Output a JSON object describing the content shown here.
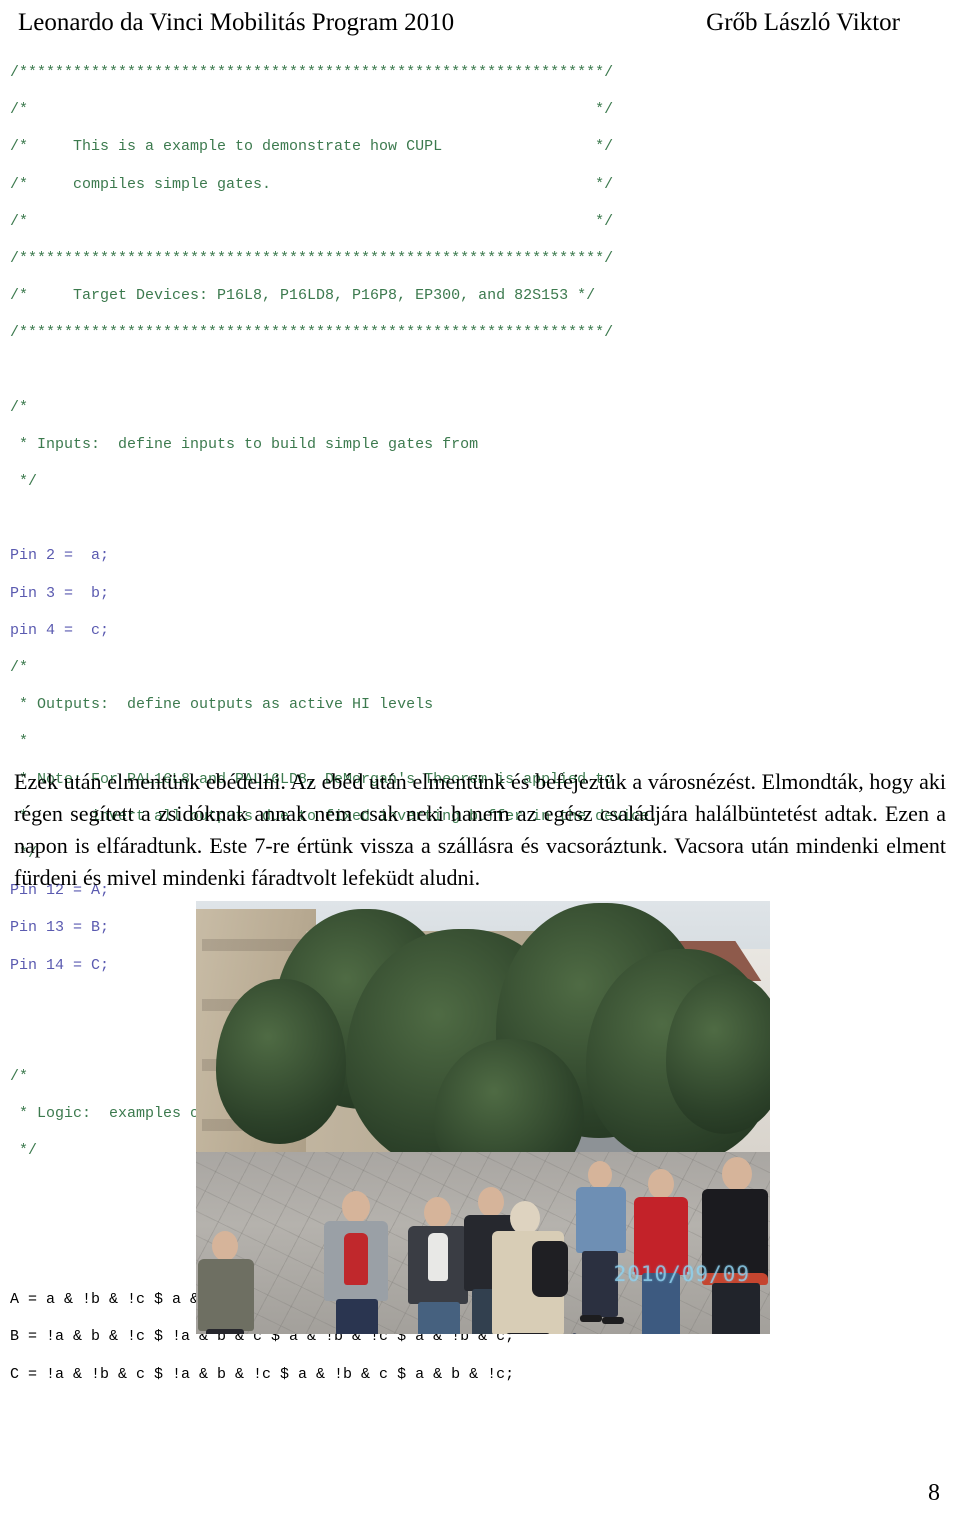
{
  "header": {
    "program_title": "Leonardo da Vinci Mobilitás Program 2010",
    "author": "Grőb László Viktor"
  },
  "code": {
    "language": "CUPL",
    "comment_color": "#3c7a4e",
    "pin_color": "#5a5ab0",
    "logic_color": "#000000",
    "lines": [
      {
        "text": "/*****************************************************************/",
        "kind": "comment"
      },
      {
        "text": "/*                                                               */",
        "kind": "comment"
      },
      {
        "text": "/*     This is a example to demonstrate how CUPL                 */",
        "kind": "comment"
      },
      {
        "text": "/*     compiles simple gates.                                    */",
        "kind": "comment"
      },
      {
        "text": "/*                                                               */",
        "kind": "comment"
      },
      {
        "text": "/*****************************************************************/",
        "kind": "comment"
      },
      {
        "text": "/*     Target Devices: P16L8, P16LD8, P16P8, EP300, and 82S153 */",
        "kind": "comment"
      },
      {
        "text": "/*****************************************************************/",
        "kind": "comment"
      },
      {
        "text": "",
        "kind": "blank"
      },
      {
        "text": "/*",
        "kind": "comment"
      },
      {
        "text": " * Inputs:  define inputs to build simple gates from",
        "kind": "comment"
      },
      {
        "text": " */",
        "kind": "comment"
      },
      {
        "text": "",
        "kind": "blank"
      },
      {
        "text": "Pin 2 =  a;",
        "kind": "pin"
      },
      {
        "text": "Pin 3 =  b;",
        "kind": "pin"
      },
      {
        "text": "pin 4 =  c;",
        "kind": "pin"
      },
      {
        "text": "/*",
        "kind": "comment"
      },
      {
        "text": " * Outputs:  define outputs as active HI levels",
        "kind": "comment"
      },
      {
        "text": " *",
        "kind": "comment"
      },
      {
        "text": " * Note: For PAL16L8 and PAL16LD8, DeMorgan's Theorem is applied to",
        "kind": "comment"
      },
      {
        "text": " *       invert all outputs due to fixed inverting buffer in the device.",
        "kind": "comment"
      },
      {
        "text": " */",
        "kind": "comment"
      },
      {
        "text": "Pin 12 = A;",
        "kind": "pin"
      },
      {
        "text": "Pin 13 = B;",
        "kind": "pin"
      },
      {
        "text": "Pin 14 = C;",
        "kind": "pin"
      },
      {
        "text": "",
        "kind": "blank"
      },
      {
        "text": "",
        "kind": "blank"
      },
      {
        "text": "/*",
        "kind": "comment"
      },
      {
        "text": " * Logic:  examples of simple gates expressed in CUPL",
        "kind": "comment"
      },
      {
        "text": " */",
        "kind": "comment"
      },
      {
        "text": "",
        "kind": "blank"
      },
      {
        "text": "",
        "kind": "blank"
      },
      {
        "text": "",
        "kind": "blank"
      },
      {
        "text": "A = a & !b & !c $ a & !b & c $ a & b & !c $ a & b & c;",
        "kind": "logic"
      },
      {
        "text": "B = !a & b & !c $ !a & b & c $ a & !b & !c $ a & !b & c;",
        "kind": "logic"
      },
      {
        "text": "C = !a & !b & c $ !a & b & !c $ a & !b & c $ a & b & !c;",
        "kind": "logic"
      }
    ]
  },
  "body": {
    "paragraph": "Ezek után elmentünk ebédelni. Az ebéd után elmentünk és befejeztük a városnézést. Elmondták, hogy aki régen segített a zsidóknak annak nem csak neki hanem az egész családjára halálbüntetést adtak. Ezen a napon is elfáradtunk. Este 7-re értünk vissza a szállásra és vacsoráztunk. Vacsora után mindenki elment fürdeni és mivel mindenki fáradtvolt lefeküdt aludni."
  },
  "photo": {
    "caption_none": "",
    "date_stamp": "2010/09/09"
  },
  "footer": {
    "page_number": "8"
  }
}
